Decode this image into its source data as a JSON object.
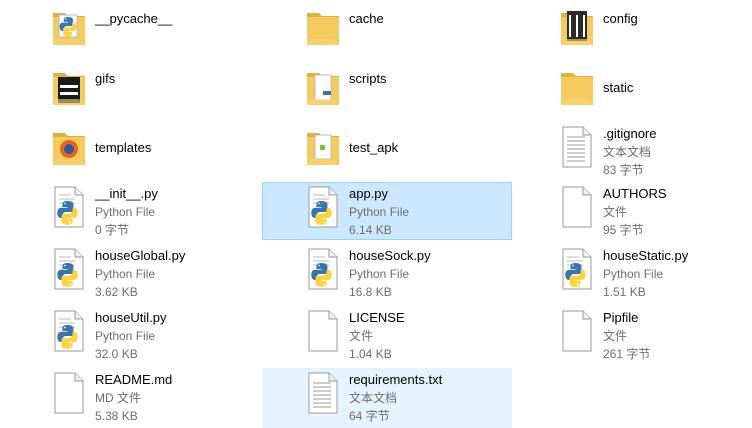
{
  "items": [
    {
      "name": "__pycache__",
      "type": "",
      "size": "",
      "icon": "folder-python-icon"
    },
    {
      "name": "cache",
      "type": "",
      "size": "",
      "icon": "folder-icon"
    },
    {
      "name": "config",
      "type": "",
      "size": "",
      "icon": "folder-config-icon"
    },
    {
      "name": "gifs",
      "type": "",
      "size": "",
      "icon": "folder-image-icon"
    },
    {
      "name": "scripts",
      "type": "",
      "size": "",
      "icon": "folder-scripts-icon"
    },
    {
      "name": "static",
      "type": "",
      "size": "",
      "icon": "folder-icon"
    },
    {
      "name": "templates",
      "type": "",
      "size": "",
      "icon": "folder-firefox-icon"
    },
    {
      "name": "test_apk",
      "type": "",
      "size": "",
      "icon": "folder-apk-icon"
    },
    {
      "name": ".gitignore",
      "type": "文本文档",
      "size": "83 字节",
      "icon": "text-document-icon"
    },
    {
      "name": "__init__.py",
      "type": "Python File",
      "size": "0 字节",
      "icon": "python-file-icon"
    },
    {
      "name": "app.py",
      "type": "Python File",
      "size": "6.14 KB",
      "icon": "python-file-icon"
    },
    {
      "name": "AUTHORS",
      "type": "文件",
      "size": "95 字节",
      "icon": "blank-file-icon"
    },
    {
      "name": "houseGlobal.py",
      "type": "Python File",
      "size": "3.62 KB",
      "icon": "python-file-icon"
    },
    {
      "name": "houseSock.py",
      "type": "Python File",
      "size": "16.8 KB",
      "icon": "python-file-icon"
    },
    {
      "name": "houseStatic.py",
      "type": "Python File",
      "size": "1.51 KB",
      "icon": "python-file-icon"
    },
    {
      "name": "houseUtil.py",
      "type": "Python File",
      "size": "32.0 KB",
      "icon": "python-file-icon"
    },
    {
      "name": "LICENSE",
      "type": "文件",
      "size": "1.04 KB",
      "icon": "blank-file-icon"
    },
    {
      "name": "Pipfile",
      "type": "文件",
      "size": "261 字节",
      "icon": "blank-file-icon"
    },
    {
      "name": "README.md",
      "type": "MD 文件",
      "size": "5.38 KB",
      "icon": "blank-file-icon"
    },
    {
      "name": "requirements.txt",
      "type": "文本文档",
      "size": "64 字节",
      "icon": "text-document-icon"
    }
  ],
  "selected_item": "app.py",
  "hovered_item": "requirements.txt",
  "colors": {
    "selection_bg": "#cce8ff",
    "selection_border": "#99d1ff",
    "hover_bg": "#e5f3ff",
    "folder": "#f4cb5c",
    "python_blue": "#3a75b0",
    "python_yellow": "#ffd340"
  }
}
